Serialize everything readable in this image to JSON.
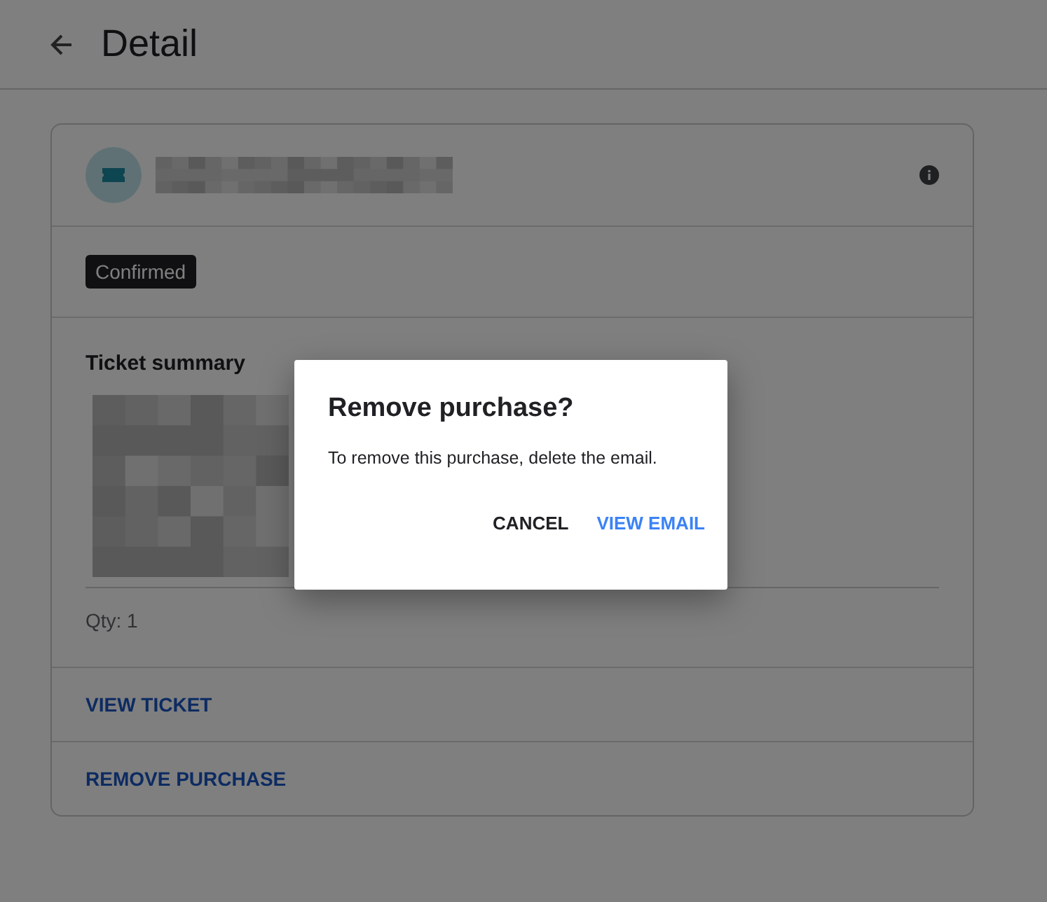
{
  "header": {
    "title": "Detail"
  },
  "card": {
    "status": "Confirmed",
    "section_title": "Ticket summary",
    "quantity": "Qty: 1",
    "actions": [
      "VIEW TICKET",
      "REMOVE PURCHASE"
    ]
  },
  "dialog": {
    "title": "Remove purchase?",
    "message": "To remove this purchase, delete the email.",
    "buttons": [
      {
        "label": "CANCEL",
        "kind": "plain"
      },
      {
        "label": "VIEW EMAIL",
        "kind": "primary"
      }
    ]
  }
}
